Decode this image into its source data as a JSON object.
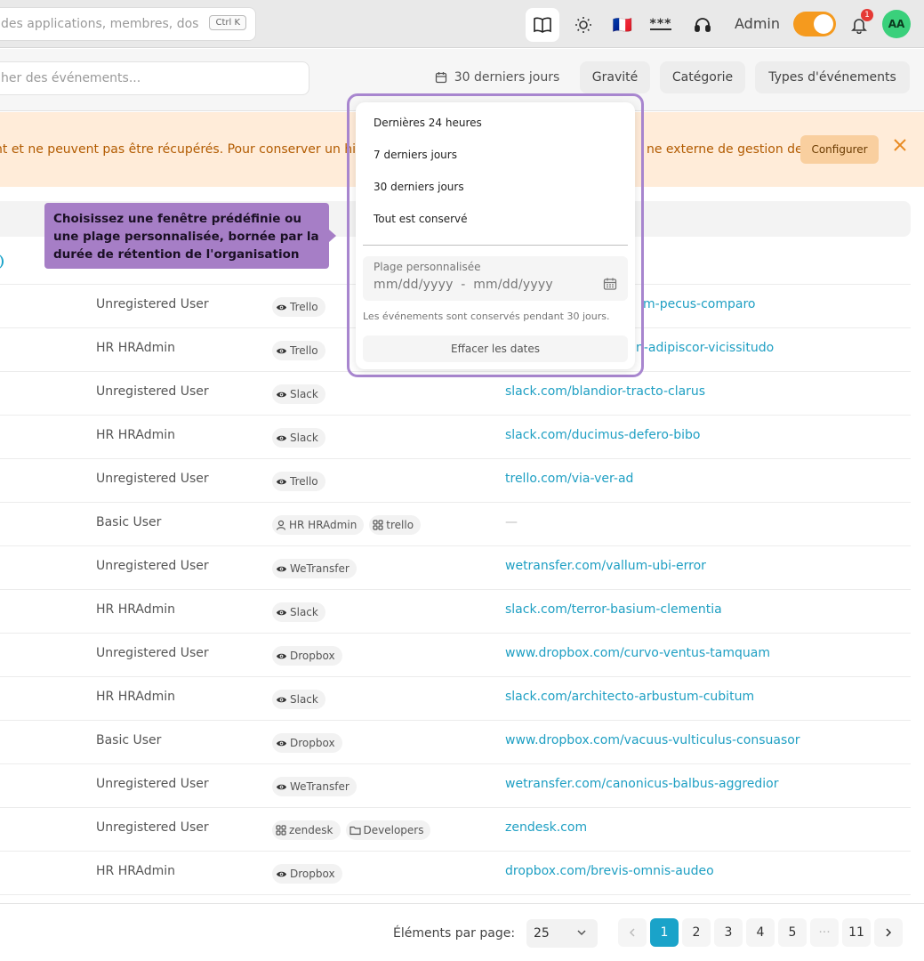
{
  "topbar": {
    "search_placeholder": "des applications, membres, doss",
    "search_shortcut": "Ctrl K",
    "flag": "🇫🇷",
    "password_glyph": "***",
    "admin_label": "Admin",
    "notification_count": "1",
    "avatar_initials": "AA",
    "accent_color": "#f59a1e"
  },
  "filters": {
    "search_placeholder": "her des événements...",
    "range_label": "30 derniers jours",
    "severity_label": "Gravité",
    "category_label": "Catégorie",
    "event_types_label": "Types d'événements"
  },
  "banner": {
    "text": "nt et ne peuvent pas être récupérés. Pour conserver un his",
    "text_tail": "ne externe de gestion des",
    "configure_label": "Configurer"
  },
  "tooltip": {
    "text": "Choisissez une fenêtre prédéfinie ou une plage personnalisée, bornée par la durée de rétention de l'organisation"
  },
  "range_dropdown": {
    "options": [
      "Dernières 24 heures",
      "7 derniers jours",
      "30 derniers jours",
      "Tout est conservé"
    ],
    "custom_label": "Plage personnalisée",
    "date_start_placeholder": "mm/dd/yyyy",
    "date_separator": "-",
    "date_end_placeholder": "mm/dd/yyyy",
    "retention_note": "Les événements sont conservés pendant 30 jours.",
    "clear_label": "Effacer les dates"
  },
  "table": {
    "rows": [
      {
        "user": "Unregistered User",
        "chips": [
          {
            "icon": "eye-icon",
            "label": "Trello"
          }
        ],
        "link": "m-pecus-comparo"
      },
      {
        "user": "HR HRAdmin",
        "chips": [
          {
            "icon": "eye-icon",
            "label": "Trello"
          }
        ],
        "link": "n-adipiscor-vicissitudo"
      },
      {
        "user": "Unregistered User",
        "chips": [
          {
            "icon": "eye-icon",
            "label": "Slack"
          }
        ],
        "link": "slack.com/blandior-tracto-clarus"
      },
      {
        "user": "HR HRAdmin",
        "chips": [
          {
            "icon": "eye-icon",
            "label": "Slack"
          }
        ],
        "link": "slack.com/ducimus-defero-bibo"
      },
      {
        "user": "Unregistered User",
        "chips": [
          {
            "icon": "eye-icon",
            "label": "Trello"
          }
        ],
        "link": "trello.com/via-ver-ad"
      },
      {
        "user": "Basic User",
        "chips": [
          {
            "icon": "user-icon",
            "label": "HR HRAdmin"
          },
          {
            "icon": "apps-icon",
            "label": "trello"
          }
        ],
        "link": "—"
      },
      {
        "user": "Unregistered User",
        "chips": [
          {
            "icon": "eye-icon",
            "label": "WeTransfer"
          }
        ],
        "link": "wetransfer.com/vallum-ubi-error"
      },
      {
        "user": "HR HRAdmin",
        "chips": [
          {
            "icon": "eye-icon",
            "label": "Slack"
          }
        ],
        "link": "slack.com/terror-basium-clementia"
      },
      {
        "user": "Unregistered User",
        "chips": [
          {
            "icon": "eye-icon",
            "label": "Dropbox"
          }
        ],
        "link": "www.dropbox.com/curvo-ventus-tamquam"
      },
      {
        "user": "HR HRAdmin",
        "chips": [
          {
            "icon": "eye-icon",
            "label": "Slack"
          }
        ],
        "link": "slack.com/architecto-arbustum-cubitum"
      },
      {
        "user": "Basic User",
        "chips": [
          {
            "icon": "eye-icon",
            "label": "Dropbox"
          }
        ],
        "link": "www.dropbox.com/vacuus-vulticulus-consuasor"
      },
      {
        "user": "Unregistered User",
        "chips": [
          {
            "icon": "eye-icon",
            "label": "WeTransfer"
          }
        ],
        "link": "wetransfer.com/canonicus-balbus-aggredior"
      },
      {
        "user": "Unregistered User",
        "chips": [
          {
            "icon": "apps-icon",
            "label": "zendesk"
          },
          {
            "icon": "folder-icon",
            "label": "Developers"
          }
        ],
        "link": "zendesk.com"
      },
      {
        "user": "HR HRAdmin",
        "chips": [
          {
            "icon": "eye-icon",
            "label": "Dropbox"
          }
        ],
        "link": "dropbox.com/brevis-omnis-audeo"
      }
    ]
  },
  "pagination": {
    "per_page_label": "Éléments par page:",
    "per_page_value": "25",
    "pages": [
      "1",
      "2",
      "3",
      "4",
      "5",
      "···",
      "11"
    ],
    "current_page": "1",
    "active_color": "#1aa3c9"
  }
}
